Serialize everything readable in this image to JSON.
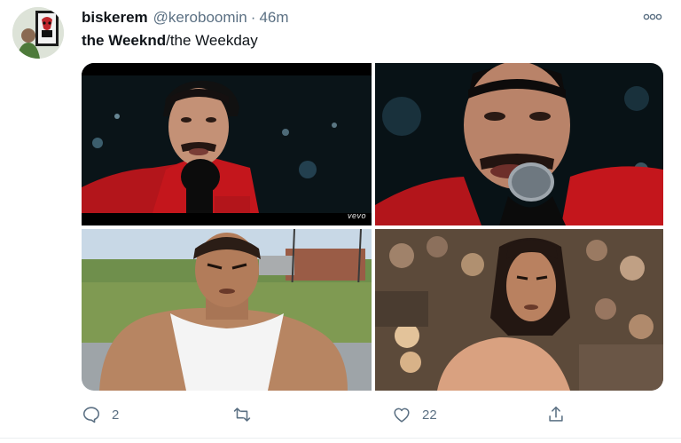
{
  "tweet": {
    "display_name": "biskerem",
    "handle": "@keroboomin",
    "separator": "·",
    "time": "46m",
    "text_bold": "the Weeknd",
    "text_rest": "/the Weekday"
  },
  "media": {
    "watermark": "vevo",
    "image_icons": [
      "photo-singer-wide",
      "photo-singer-closeup",
      "photo-wrestler-outdoor",
      "photo-wrestler-arena"
    ]
  },
  "actions": {
    "reply_count": "2",
    "retweet_count": "",
    "like_count": "22"
  },
  "colors": {
    "text": "#0f1419",
    "muted": "#5b7083",
    "divider": "#ebeef0",
    "jacket_red": "#c4161c"
  },
  "icons": [
    "more-icon",
    "reply-icon",
    "retweet-icon",
    "like-icon",
    "share-icon"
  ]
}
